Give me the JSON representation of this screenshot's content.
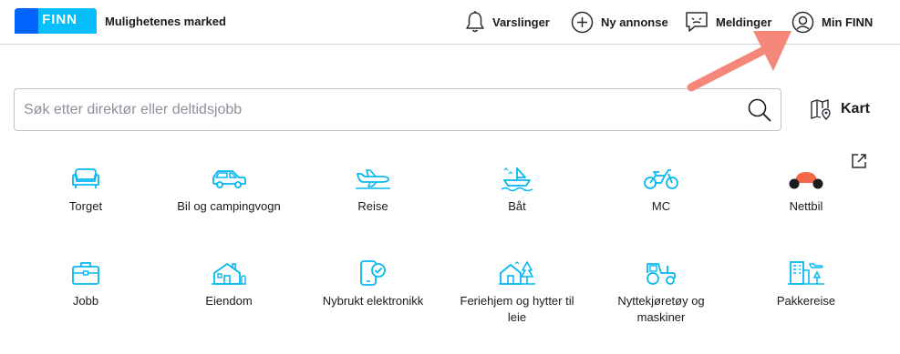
{
  "header": {
    "logo_text": "FINN",
    "tagline": "Mulighetenes marked",
    "nav": {
      "notifications": "Varslinger",
      "new_ad": "Ny annonse",
      "messages": "Meldinger",
      "my_finn": "Min FINN"
    }
  },
  "search": {
    "placeholder": "Søk etter direktør eller deltidsjobb",
    "value": ""
  },
  "map_label": "Kart",
  "categories": [
    {
      "label": "Torget",
      "icon": "sofa-icon"
    },
    {
      "label": "Bil og campingvogn",
      "icon": "car-icon"
    },
    {
      "label": "Reise",
      "icon": "airplane-icon"
    },
    {
      "label": "Båt",
      "icon": "boat-icon"
    },
    {
      "label": "MC",
      "icon": "motorcycle-icon"
    },
    {
      "label": "Nettbil",
      "icon": "nettbil-icon"
    },
    {
      "label": "Jobb",
      "icon": "briefcase-icon"
    },
    {
      "label": "Eiendom",
      "icon": "house-icon"
    },
    {
      "label": "Nybrukt elektronikk",
      "icon": "phone-check-icon"
    },
    {
      "label": "Feriehjem og hytter til leie",
      "icon": "cabin-icon"
    },
    {
      "label": "Nyttekjøretøy og maskiner",
      "icon": "tractor-icon"
    },
    {
      "label": "Pakkereise",
      "icon": "package-trip-icon"
    }
  ],
  "colors": {
    "brand_blue": "#0063fb",
    "brand_cyan": "#06befb",
    "icon_blue": "#06b8f0",
    "nettbil_orange": "#f26849",
    "annotation_arrow": "#f4877a"
  }
}
